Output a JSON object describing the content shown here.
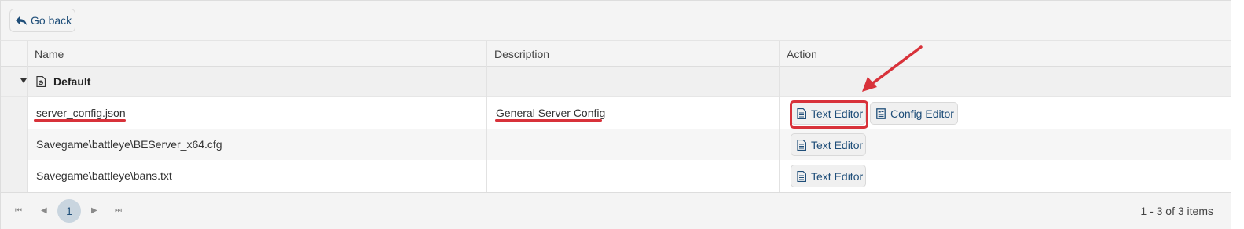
{
  "toolbar": {
    "go_back_label": "Go back"
  },
  "grid": {
    "columns": [
      "Name",
      "Description",
      "Action"
    ],
    "group": {
      "label": "Default"
    },
    "rows": [
      {
        "name": "server_config.json",
        "description": "General Server Config",
        "actions": [
          "Text Editor",
          "Config Editor"
        ]
      },
      {
        "name": "Savegame\\battleye\\BEServer_x64.cfg",
        "description": "",
        "actions": [
          "Text Editor"
        ]
      },
      {
        "name": "Savegame\\battleye\\bans.txt",
        "description": "",
        "actions": [
          "Text Editor"
        ]
      }
    ]
  },
  "pager": {
    "current_page": "1",
    "info": "1 - 3 of 3 items"
  },
  "colors": {
    "accent": "#1f4e79",
    "annotation": "#d8323a",
    "current_page_bg": "#c9d5df"
  }
}
